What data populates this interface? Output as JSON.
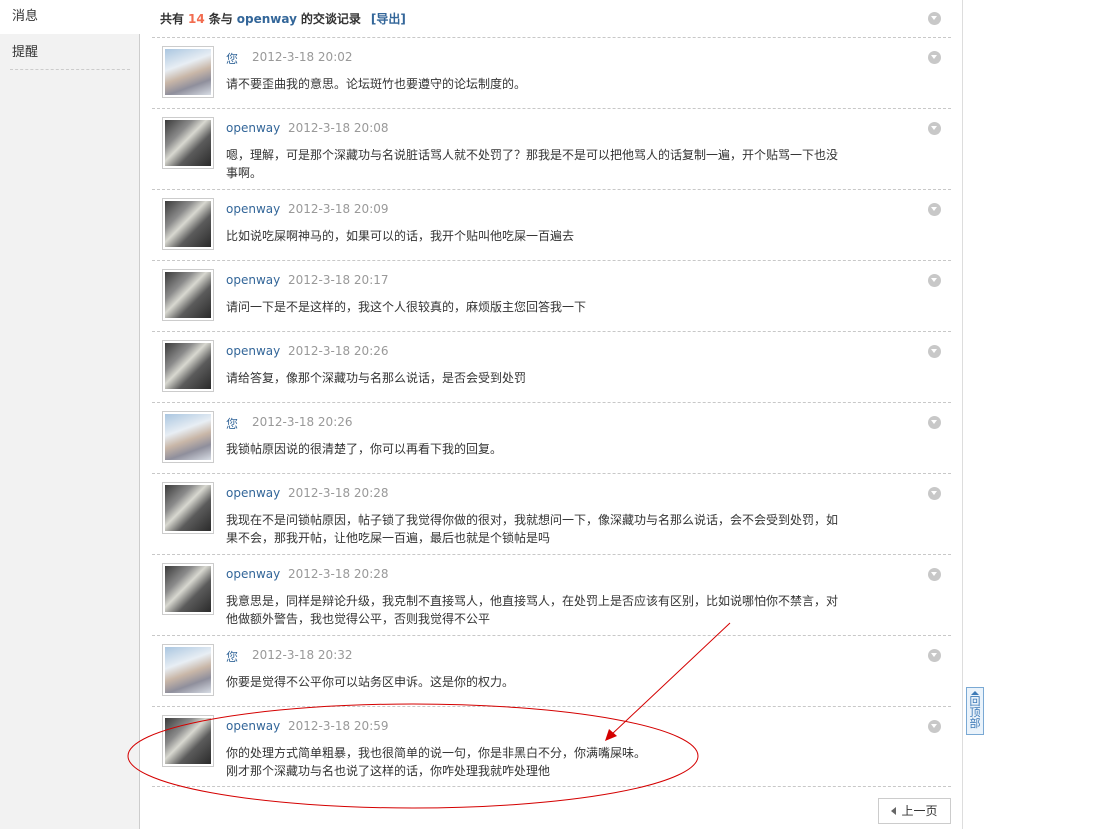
{
  "sidebar": {
    "items": [
      {
        "label": "消息",
        "active": true
      },
      {
        "label": "提醒",
        "active": false
      }
    ]
  },
  "header": {
    "prefix": "共有",
    "count": "14",
    "middle": "条与",
    "user": "openway",
    "suffix": "的交谈记录",
    "export_label": "[导出]"
  },
  "messages": [
    {
      "sender": "您",
      "time": "2012-3-18 20:02",
      "text": "请不要歪曲我的意思。论坛斑竹也要遵守的论坛制度的。",
      "avatar": "me"
    },
    {
      "sender": "openway",
      "time": "2012-3-18 20:08",
      "text": "嗯，理解，可是那个深藏功与名说脏话骂人就不处罚了？那我是不是可以把他骂人的话复制一遍，开个贴骂一下也没事啊。",
      "avatar": "other"
    },
    {
      "sender": "openway",
      "time": "2012-3-18 20:09",
      "text": "比如说吃屎啊神马的，如果可以的话，我开个贴叫他吃屎一百遍去",
      "avatar": "other"
    },
    {
      "sender": "openway",
      "time": "2012-3-18 20:17",
      "text": "请问一下是不是这样的，我这个人很较真的，麻烦版主您回答我一下",
      "avatar": "other"
    },
    {
      "sender": "openway",
      "time": "2012-3-18 20:26",
      "text": "请给答复，像那个深藏功与名那么说话，是否会受到处罚",
      "avatar": "other"
    },
    {
      "sender": "您",
      "time": "2012-3-18 20:26",
      "text": "我锁帖原因说的很清楚了，你可以再看下我的回复。",
      "avatar": "me"
    },
    {
      "sender": "openway",
      "time": "2012-3-18 20:28",
      "text": "我现在不是问锁帖原因，帖子锁了我觉得你做的很对，我就想问一下，像深藏功与名那么说话，会不会受到处罚，如果不会，那我开帖，让他吃屎一百遍，最后也就是个锁帖是吗",
      "avatar": "other"
    },
    {
      "sender": "openway",
      "time": "2012-3-18 20:28",
      "text": "我意思是，同样是辩论升级，我克制不直接骂人，他直接骂人，在处罚上是否应该有区别，比如说哪怕你不禁言，对他做额外警告，我也觉得公平，否则我觉得不公平",
      "avatar": "other"
    },
    {
      "sender": "您",
      "time": "2012-3-18 20:32",
      "text": "你要是觉得不公平你可以站务区申诉。这是你的权力。",
      "avatar": "me"
    },
    {
      "sender": "openway",
      "time": "2012-3-18 20:59",
      "text": "你的处理方式简单粗暴，我也很简单的说一句，你是非黑白不分，你满嘴屎味。\n刚才那个深藏功与名也说了这样的话，你咋处理我就咋处理他",
      "avatar": "other"
    }
  ],
  "pager": {
    "prev_label": "上一页"
  },
  "back_to_top": {
    "label": "回顶部"
  },
  "colors": {
    "link": "#336699",
    "count": "#f26c4f",
    "annotation": "#d40000"
  }
}
